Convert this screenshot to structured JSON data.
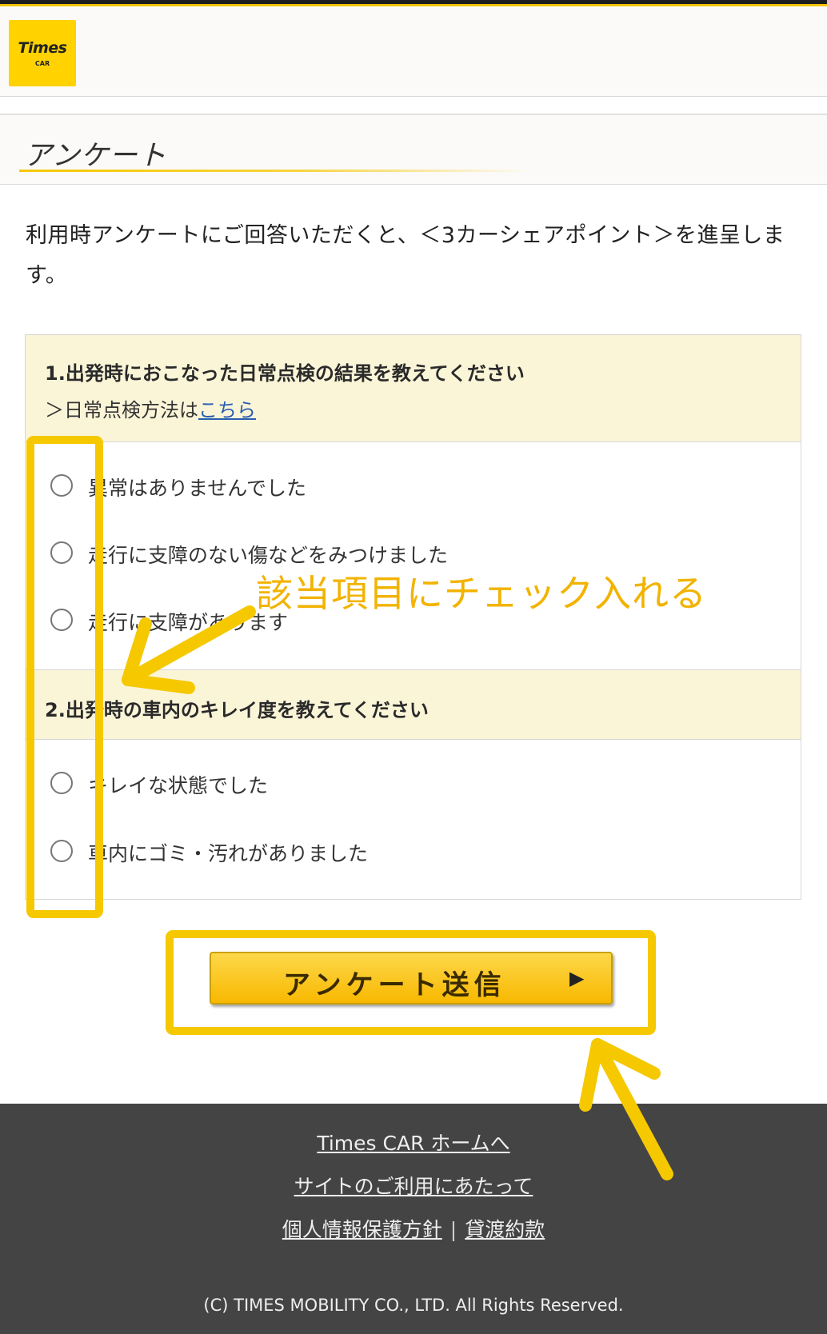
{
  "logo": {
    "main": "Times",
    "sub": "CAR"
  },
  "page": {
    "title": "アンケート"
  },
  "intro": "利用時アンケートにご回答いただくと、＜3カーシェアポイント＞を進呈します。",
  "questions": [
    {
      "title": "1.出発時におこなった日常点検の結果を教えてください",
      "sub_prefix": "＞日常点検方法は",
      "sub_link": "こちら",
      "options": [
        "異常はありませんでした",
        "走行に支障のない傷などをみつけました",
        "走行に支障があります"
      ]
    },
    {
      "title": "2.出発時の車内のキレイ度を教えてください",
      "options": [
        "キレイな状態でした",
        "車内にゴミ・汚れがありました"
      ]
    }
  ],
  "submit": {
    "label": "アンケート送信",
    "arrow": "▶"
  },
  "footer": {
    "home_link": "Times CAR ホームへ",
    "usage_link": "サイトのご利用にあたって",
    "privacy_link": "個人情報保護方針",
    "separator": "|",
    "terms_link": "貸渡約款",
    "copyright": "(C) TIMES MOBILITY CO., LTD. All Rights Reserved."
  },
  "annotation": {
    "text": "該当項目にチェック入れる",
    "color": "#f5c800"
  }
}
